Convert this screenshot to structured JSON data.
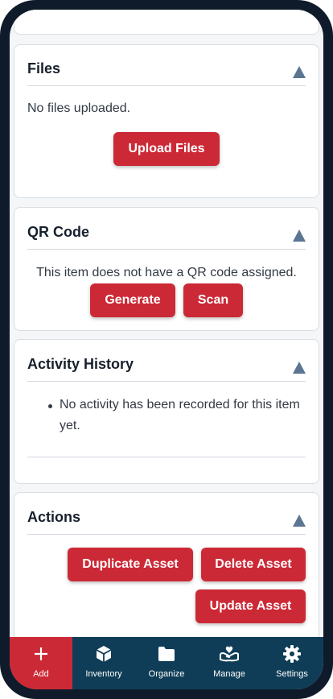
{
  "files": {
    "title": "Files",
    "empty_text": "No files uploaded.",
    "upload_label": "Upload Files"
  },
  "qr": {
    "title": "QR Code",
    "empty_text": "This item does not have a QR code assigned.",
    "generate_label": "Generate",
    "scan_label": "Scan"
  },
  "activity": {
    "title": "Activity History",
    "items": [
      "No activity has been recorded for this item",
      "yet."
    ]
  },
  "actions": {
    "title": "Actions",
    "duplicate_label": "Duplicate Asset",
    "delete_label": "Delete Asset",
    "update_label": "Update Asset"
  },
  "nav": {
    "items": [
      {
        "label": "Add",
        "icon": "plus-icon",
        "active": true
      },
      {
        "label": "Inventory",
        "icon": "box-icon",
        "active": false
      },
      {
        "label": "Organize",
        "icon": "folder-icon",
        "active": false
      },
      {
        "label": "Manage",
        "icon": "hand-heart-icon",
        "active": false
      },
      {
        "label": "Settings",
        "icon": "gear-icon",
        "active": false
      }
    ]
  },
  "colors": {
    "accent": "#cc2936",
    "nav_bg": "#0f3d57",
    "toggle": "#5b7592"
  }
}
